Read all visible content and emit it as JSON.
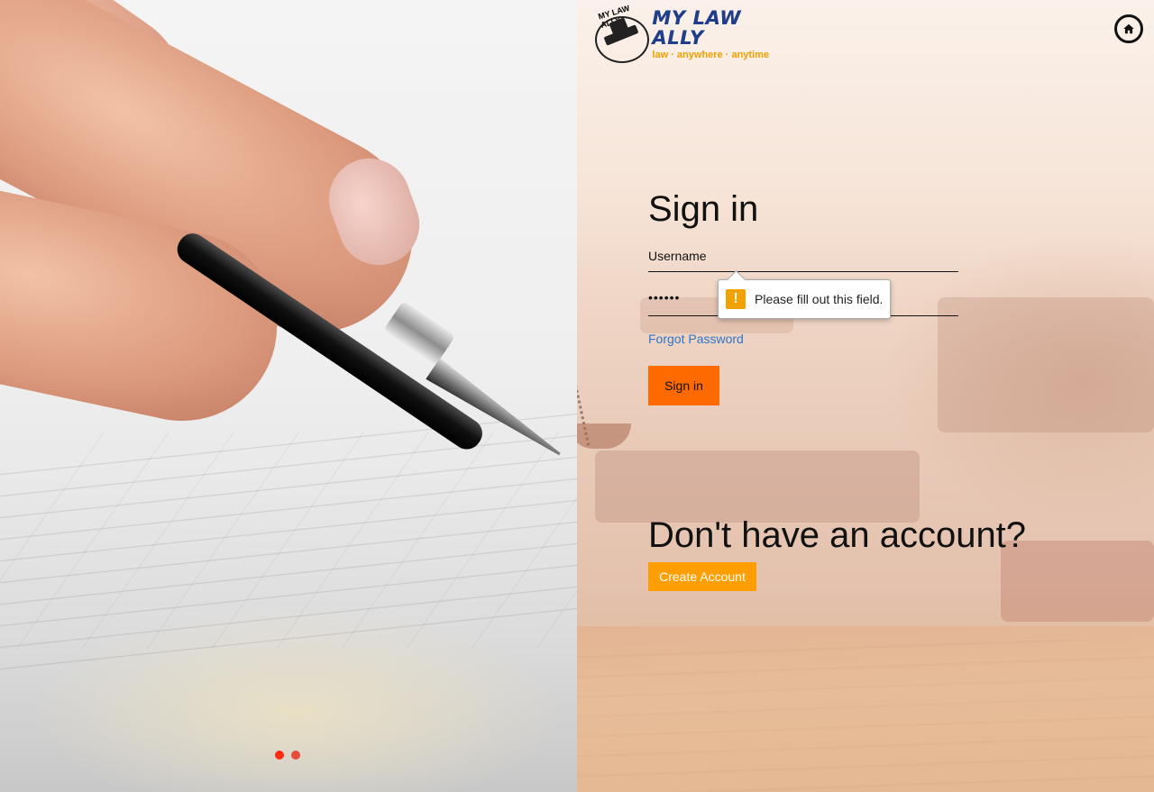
{
  "brand": {
    "name": "MY LAW ALLY",
    "tagline": "law · anywhere · anytime",
    "logo_arc_text": "MY LAW ALLY"
  },
  "header": {
    "home_icon": "home-icon"
  },
  "signin": {
    "title": "Sign in",
    "username_label": "Username",
    "password_value_masked": "••••••",
    "forgot_password": "Forgot Password",
    "signin_button": "Sign in"
  },
  "validation": {
    "message": "Please fill out this field.",
    "icon": "warning-icon"
  },
  "signup": {
    "prompt": "Don't have an account?",
    "create_button": "Create Account"
  },
  "carousel": {
    "dots": [
      {
        "active": true
      },
      {
        "active": false
      }
    ]
  },
  "colors": {
    "brand_blue": "#1f3f8a",
    "brand_orange": "#f0a000",
    "signin_button": "#ff6a00",
    "create_button": "#ff9e00",
    "link": "#2f75c6",
    "carousel_dot": "#e74c3c"
  }
}
